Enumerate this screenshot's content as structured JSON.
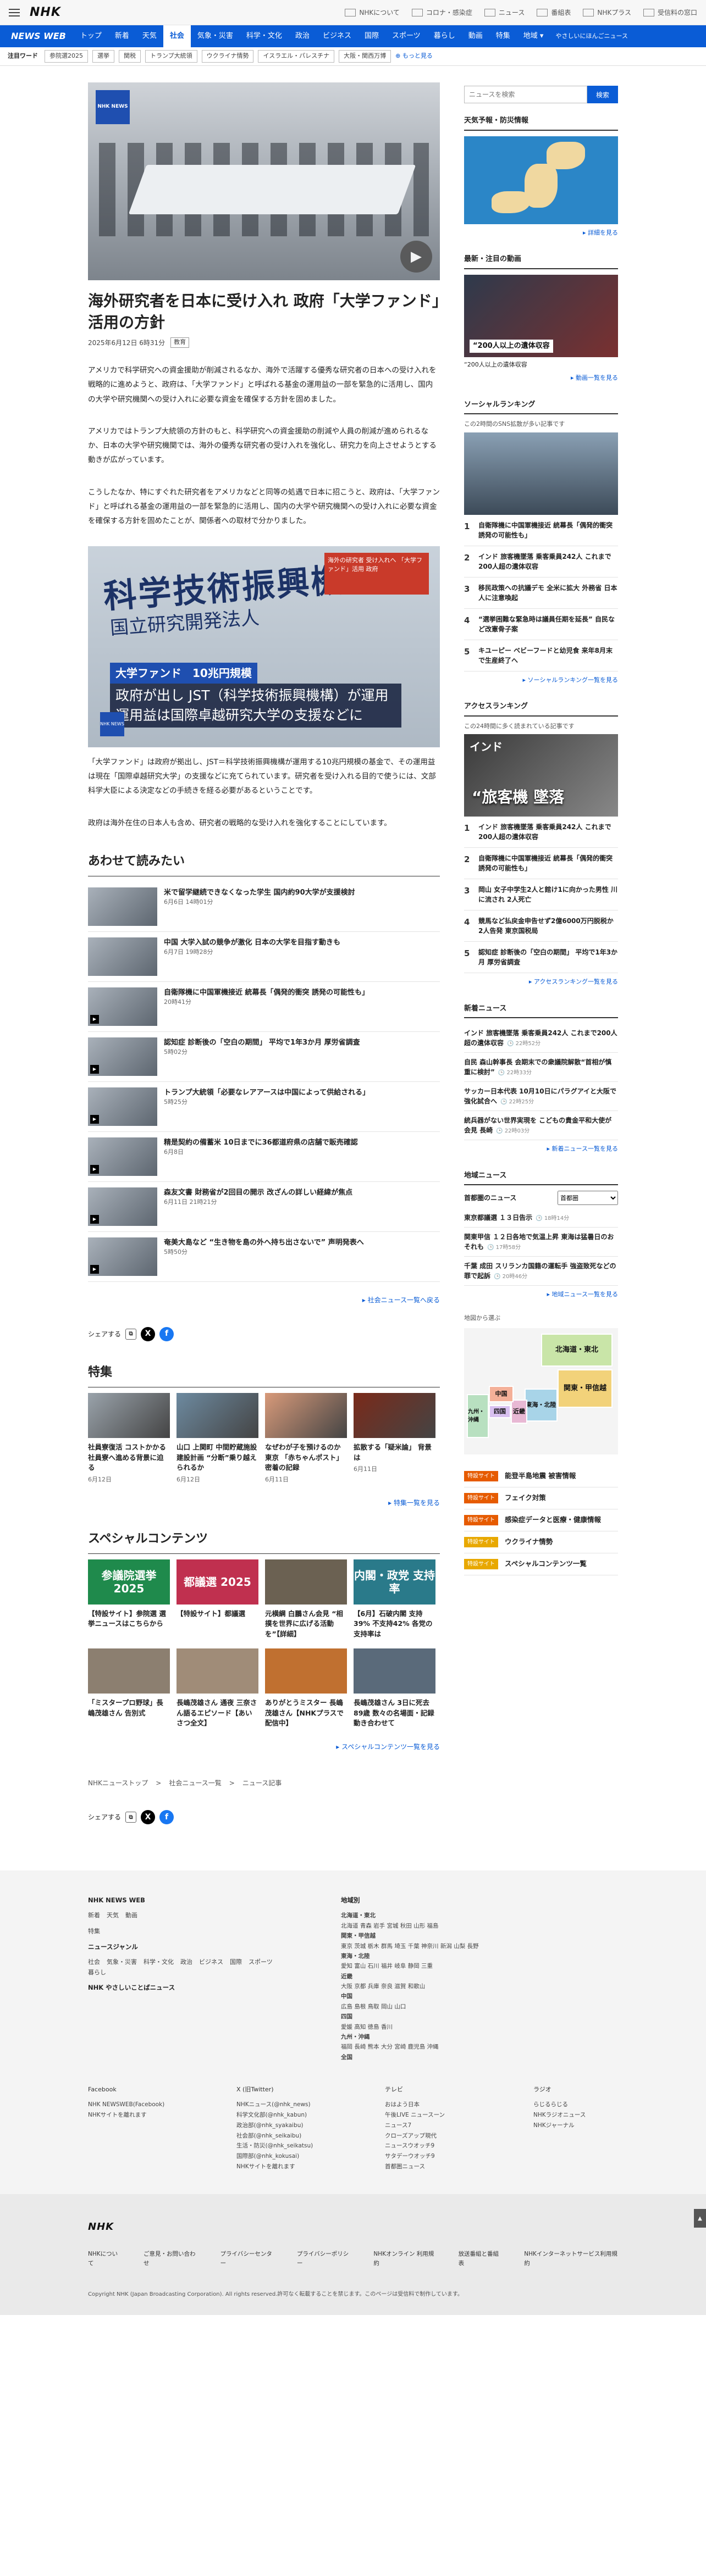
{
  "header": {
    "logo": "NHK",
    "links": [
      "NHKについて",
      "コロナ・感染症",
      "ニュース",
      "番組表",
      "NHKプラス",
      "受信料の窓口"
    ]
  },
  "nav": {
    "brand": "NEWS WEB",
    "items": [
      "トップ",
      "新着",
      "天気",
      "社会",
      "気象・災害",
      "科学・文化",
      "政治",
      "ビジネス",
      "国際",
      "スポーツ",
      "暮らし",
      "動画",
      "特集",
      "地域"
    ],
    "active": "社会",
    "easy": [
      "やさしいにほんご",
      "ニュース"
    ]
  },
  "trend": {
    "label": "注目ワード",
    "tags": [
      "参院選2025",
      "選挙",
      "関税",
      "トランプ大統領",
      "ウクライナ情勢",
      "イスラエル・パレスチナ",
      "大阪・関西万博"
    ],
    "more": "もっと見る"
  },
  "article": {
    "hero_badge": "NHK NEWS",
    "title": "海外研究者を日本に受け入れ 政府「大学ファンド」活用の方針",
    "date": "2025年6月12日 6時31分",
    "category": "教育",
    "p1": "アメリカで科学研究への資金援助が削減されるなか、海外で活躍する優秀な研究者の日本への受け入れを戦略的に進めようと、政府は、「大学ファンド」と呼ばれる基金の運用益の一部を緊急的に活用し、国内の大学や研究機関への受け入れに必要な資金を確保する方針を固めました。",
    "p2": "アメリカではトランプ大統領の方針のもと、科学研究への資金援助の削減や人員の削減が進められるなか、日本の大学や研究機関では、海外の優秀な研究者の受け入れを強化し、研究力を向上させようとする動きが広がっています。",
    "p3": "こうしたなか、特にすぐれた研究者をアメリカなどと同等の処遇で日本に招こうと、政府は、「大学ファンド」と呼ばれる基金の運用益の一部を緊急的に活用し、国内の大学や研究機関への受け入れに必要な資金を確保する方針を固めたことが、関係者への取材で分かりました。",
    "fig_big": "科学技術振興機構",
    "fig_big2": "国立研究開発法人",
    "fig_inset": "海外の研究者 受け入れへ 「大学ファンド」活用 政府",
    "fig_cap1": "大学ファンド　10兆円規模",
    "fig_cap2": "政府が出し JST（科学技術振興機構）が運用 運用益は国際卓越研究大学の支援などに",
    "p4": "「大学ファンド」は政府が拠出し、JST＝科学技術振興機構が運用する10兆円規模の基金で、その運用益は現在「国際卓越研究大学」の支援などに充てられています。研究者を受け入れる目的で使うには、文部科学大臣による決定などの手続きを経る必要があるということです。",
    "p5": "政府は海外在住の日本人も含め、研究者の戦略的な受け入れを強化することにしています。"
  },
  "related": {
    "heading": "あわせて読みたい",
    "items": [
      {
        "title": "米で留学継続できなくなった学生 国内約90大学が支援検討",
        "time": "6月6日 14時01分"
      },
      {
        "title": "中国 大学入試の競争が激化 日本の大学を目指す動きも",
        "time": "6月7日 19時28分"
      },
      {
        "title": "自衛隊機に中国軍機接近 統幕長「偶発的衝突 誘発の可能性も」",
        "time": "20時41分"
      },
      {
        "title": "認知症 診断後の「空白の期間」 平均で1年3か月 厚労省調査",
        "time": "5時02分"
      },
      {
        "title": "トランプ大統領「必要なレアアースは中国によって供給される」",
        "time": "5時25分"
      },
      {
        "title": "精是契約の備蓄米 10日までに36都道府県の店舗で販売確認",
        "time": "6月8日"
      },
      {
        "title": "森友文書 財務省が2回目の開示 改ざんの詳しい経緯が焦点",
        "time": "6月11日 21時21分"
      },
      {
        "title": "奄美大島など “生き物を島の外へ持ち出さないで” 声明発表へ",
        "time": "5時50分"
      }
    ],
    "more": "社会ニュース一覧へ戻る"
  },
  "share": {
    "label": "シェアする",
    "x": "X",
    "fb": "f"
  },
  "features": {
    "heading": "特集",
    "items": [
      {
        "title": "社員寮復活 コストかかる社員寮へ進める背景に迫る",
        "date": "6月12日"
      },
      {
        "title": "山口 上関町 中間貯蔵施設建設計画 “分断”乗り越えられるか",
        "date": "6月12日"
      },
      {
        "title": "なぜわが子を預けるのか 東京 「赤ちゃんポスト」 密着の記録",
        "date": "6月11日"
      },
      {
        "title": "拡散する「疑米論」 背景は",
        "date": "6月11日"
      }
    ],
    "more": "特集一覧を見る"
  },
  "special": {
    "heading": "スペシャルコンテンツ",
    "items": [
      {
        "label": "参議院選挙 2025",
        "title": "【特設サイト】参院選 選挙ニュースはこちらから",
        "color": "#1f8a4c"
      },
      {
        "label": "都議選 2025",
        "title": "【特設サイト】都議選",
        "color": "#c0304f"
      },
      {
        "label": "",
        "title": "元横綱 白鵬さん会見 “相撲を世界に広げる活動を”【詳細】",
        "color": "#6b6152"
      },
      {
        "label": "内閣・政党 支持率",
        "title": "【6月】石破内閣 支持39% 不支持42% 各党の支持率は",
        "color": "#2a7a8a"
      },
      {
        "label": "",
        "title": "「ミスタープロ野球」長嶋茂雄さん 告別式",
        "color": "#8c7f70"
      },
      {
        "label": "",
        "title": "長嶋茂雄さん 通夜 三奈さん語るエピソード【あいさつ全文】",
        "color": "#a08c78"
      },
      {
        "label": "",
        "title": "ありがとうミスター 長嶋茂雄さん【NHKプラスで配信中】",
        "color": "#c07030"
      },
      {
        "label": "",
        "title": "長嶋茂雄さん 3日に死去 89歳 数々の名場面・記録 動き合わせて",
        "color": "#5a6a7a"
      }
    ],
    "more": "スペシャルコンテンツ一覧を見る"
  },
  "breadcrumb": [
    "NHKニューストップ",
    "社会ニュース一覧",
    "ニュース記事"
  ],
  "sidebar": {
    "search_placeholder": "ニュースを検索",
    "search_button": "検索",
    "weather_title": "天気予報・防災情報",
    "weather_link": "詳細を見る",
    "video_title": "最新・注目の動画",
    "video_label": "“200人以上の遺体収容",
    "video_caption": "“200人以上の遺体収容",
    "video_link": "動画一覧を見る",
    "social_title": "ソーシャルランキング",
    "social_note": "この2時間のSNS拡散が多い記事です",
    "social_items": [
      "自衛隊機に中国軍機接近 統幕長「偶発的衝突 誘発の可能性も」",
      "インド 旅客機墜落 乗客乗員242人 これまで200人超の遺体収容",
      "移民政策への抗議デモ 全米に拡大 外務省 日本人に注意喚起",
      "“選挙困難な緊急時は議員任期を延長” 自民など改憲骨子案",
      "キユーピー ベビーフードと幼児食 来年8月末で生産終了へ"
    ],
    "social_link": "ソーシャルランキング一覧を見る",
    "access_title": "アクセスランキング",
    "access_note": "この24時間に多く読まれている記事です",
    "access_big": "“旅客機 墜落",
    "access_big_top": "インド",
    "access_items": [
      "インド 旅客機墜落 乗客乗員242人 これまで200人超の遺体収容",
      "自衛隊機に中国軍機接近 統幕長「偶発的衝突 誘発の可能性も」",
      "岡山 女子中学生2人と館け1に向かった男性 川に流され 2人死亡",
      "競馬など払戻金申告せず2億6000万円脱税か 2人告発 東京国税局",
      "認知症 診断後の「空白の期間」 平均で1年3か月 厚労省調査"
    ],
    "access_link": "アクセスランキング一覧を見る",
    "latest_title": "新着ニュース",
    "latest_items": [
      {
        "title": "インド 旅客機墜落 乗客乗員242人 これまで200人超の遺体収容",
        "time": "22時52分"
      },
      {
        "title": "自民 森山幹事長 会期末での衆議院解散“首相が慎重に検討”",
        "time": "22時33分"
      },
      {
        "title": "サッカー日本代表 10月10日にパラグアイと大阪で強化試合へ",
        "time": "22時25分"
      },
      {
        "title": "統兵器がない世界実現を こどもの貴金平和大使が会見 長崎",
        "time": "22時03分"
      }
    ],
    "latest_link": "新着ニュース一覧を見る",
    "local_title": "地域ニュース",
    "local_label": "首都圏のニュース",
    "local_select": "首都圏",
    "local_items": [
      {
        "title": "東京都議選 １３日告示",
        "time": "18時14分"
      },
      {
        "title": "関東甲信 １２日各地で気温上昇 東海は猛暑日のおそれも",
        "time": "17時58分"
      },
      {
        "title": "千葉 成田 スリランカ国籍の運転手 強盗致死などの罪で起訴",
        "time": "20時46分"
      }
    ],
    "local_link": "地域ニュース一覧を見る",
    "map_title": "地図から選ぶ",
    "map_regions": [
      "北海道・東北",
      "関東・甲信越",
      "東海・北陸",
      "近畿",
      "中国",
      "四国",
      "九州・沖縄"
    ],
    "special_links": [
      {
        "badge": "特設サイト",
        "title": "能登半島地震 被害情報",
        "yellow": false
      },
      {
        "badge": "特設サイト",
        "title": "フェイク対策",
        "yellow": false
      },
      {
        "badge": "特設サイト",
        "title": "感染症データと医療・健康情報",
        "yellow": false
      },
      {
        "badge": "特設サイト",
        "title": "ウクライナ情勢",
        "yellow": true
      },
      {
        "badge": "特設サイト",
        "title": "スペシャルコンテンツ一覧",
        "yellow": true
      }
    ]
  },
  "footer": {
    "site": "NHK NEWS WEB",
    "nav1": [
      "新着",
      "天気",
      "動画"
    ],
    "nav2": [
      "特集"
    ],
    "news_list": "ニュースジャンル",
    "genres": [
      "社会",
      "気象・災害",
      "科学・文化",
      "政治",
      "ビジネス",
      "国際",
      "スポーツ",
      "暮らし"
    ],
    "easy": "NHK やさしいことばニュース",
    "region_title": "地域別",
    "region_rows": [
      "北海道・東北",
      "北海道 青森 岩手 宮城 秋田 山形 福島",
      "関東・甲信越",
      "東京 茨城 栃木 群馬 埼玉 千葉 神奈川 新潟 山梨 長野",
      "東海・北陸",
      "愛知 富山 石川 福井 岐阜 静岡 三重",
      "近畿",
      "大阪 京都 兵庫 奈良 滋賀 和歌山",
      "中国",
      "広島 島根 鳥取 岡山 山口",
      "四国",
      "愛媛 高知 徳島 香川",
      "九州・沖縄",
      "福岡 長崎 熊本 大分 宮崎 鹿児島 沖縄",
      "全国"
    ],
    "sns_cols": [
      {
        "h": "Facebook",
        "lines": [
          "NHK NEWSWEB(Facebook)",
          "NHKサイトを離れます"
        ]
      },
      {
        "h": "X (旧Twitter)",
        "lines": [
          "NHKニュース(@nhk_news)",
          "科学文化部(@nhk_kabun)",
          "政治部(@nhk_syakaibu)",
          "社会部(@nhk_seikaibu)",
          "生活・防災(@nhk_seikatsu)",
          "国際部(@nhk_kokusai)",
          "NHKサイトを離れます"
        ]
      },
      {
        "h": "テレビ",
        "lines": [
          "おはよう日本",
          "午後LIVE ニュースーン",
          "ニュース7",
          "クローズアップ現代",
          "ニュースウオッチ9",
          "サタデーウオッチ9",
          "首都圏ニュース"
        ]
      },
      {
        "h": "ラジオ",
        "lines": [
          "らじるらじる",
          "NHKラジオニュース",
          "NHKジャーナル"
        ]
      }
    ],
    "bottom_logo": "NHK",
    "bottom_links": [
      "NHKについて",
      "ご意見・お問い合わせ",
      "プライバシーセンター",
      "プライバシーポリシー",
      "NHKオンライン 利用規約",
      "放送番組と番組表",
      "NHKインターネットサービス利用規約"
    ],
    "copyright": "Copyright NHK (Japan Broadcasting Corporation). All rights reserved.許可なく転載することを禁じます。このページは受信料で制作しています。"
  }
}
